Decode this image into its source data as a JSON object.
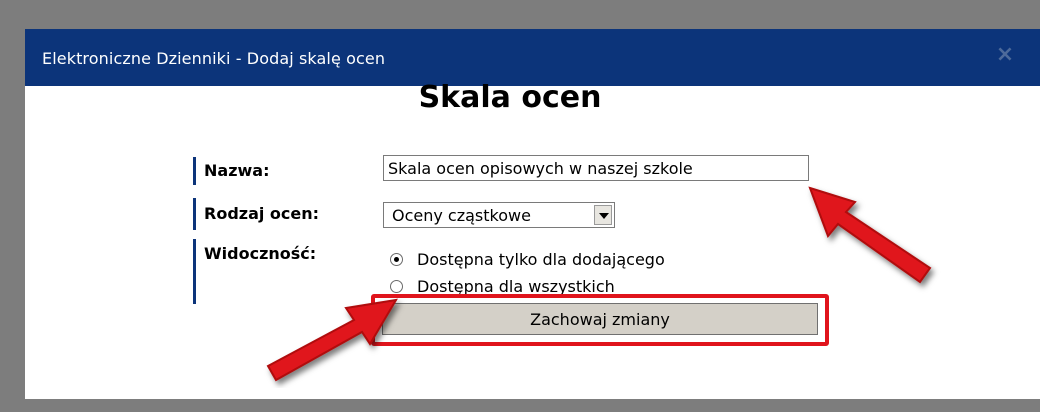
{
  "window": {
    "title": "Elektroniczne Dzienniki - Dodaj skalę ocen",
    "close_symbol": "×"
  },
  "form": {
    "heading": "Skala ocen",
    "name_label": "Nazwa:",
    "name_value": "Skala ocen opisowych w naszej szkole",
    "type_label": "Rodzaj ocen:",
    "type_selected": "Oceny cząstkowe",
    "visibility_label": "Widoczność:",
    "visibility_options": [
      {
        "label": "Dostępna tylko dla dodającego",
        "checked": true
      },
      {
        "label": "Dostępna dla wszystkich",
        "checked": false
      }
    ],
    "save_label": "Zachowaj zmiany"
  },
  "colors": {
    "titlebar": "#0c347a",
    "highlight": "#e0141c",
    "arrow": "#e0141c"
  },
  "annotations": {
    "arrows": [
      "red-arrow-pointing-to-name-input",
      "red-arrow-pointing-to-visibility-radio"
    ]
  }
}
